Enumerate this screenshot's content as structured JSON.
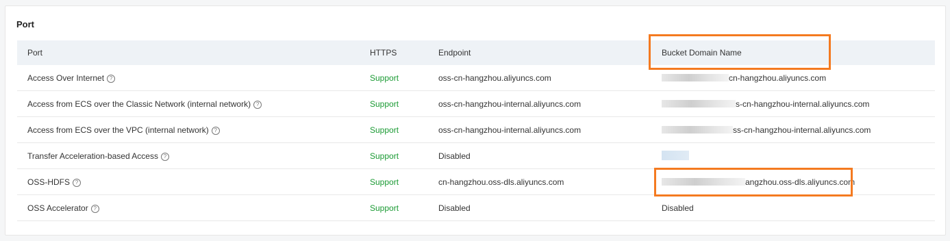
{
  "section_title": "Port",
  "columns": [
    "Port",
    "HTTPS",
    "Endpoint",
    "Bucket Domain Name"
  ],
  "rows": [
    {
      "port": "Access Over Internet",
      "https": "Support",
      "endpoint": "oss-cn-hangzhou.aliyuncs.com",
      "domain_visible": "cn-hangzhou.aliyuncs.com"
    },
    {
      "port": "Access from ECS over the Classic Network (internal network)",
      "https": "Support",
      "endpoint": "oss-cn-hangzhou-internal.aliyuncs.com",
      "domain_visible": "s-cn-hangzhou-internal.aliyuncs.com"
    },
    {
      "port": "Access from ECS over the VPC (internal network)",
      "https": "Support",
      "endpoint": "oss-cn-hangzhou-internal.aliyuncs.com",
      "domain_visible": "ss-cn-hangzhou-internal.aliyuncs.com"
    },
    {
      "port": "Transfer Acceleration-based Access",
      "https": "Support",
      "endpoint": "Disabled",
      "domain_visible": ""
    },
    {
      "port": "OSS-HDFS",
      "https": "Support",
      "endpoint": "cn-hangzhou.oss-dls.aliyuncs.com",
      "domain_visible": "angzhou.oss-dls.aliyuncs.com"
    },
    {
      "port": "OSS Accelerator",
      "https": "Support",
      "endpoint": "Disabled",
      "domain_visible": "Disabled"
    }
  ],
  "help_icon_glyph": "?",
  "colors": {
    "support": "#1a9a33",
    "highlight": "#f47a20",
    "header_bg": "#eef2f6"
  }
}
